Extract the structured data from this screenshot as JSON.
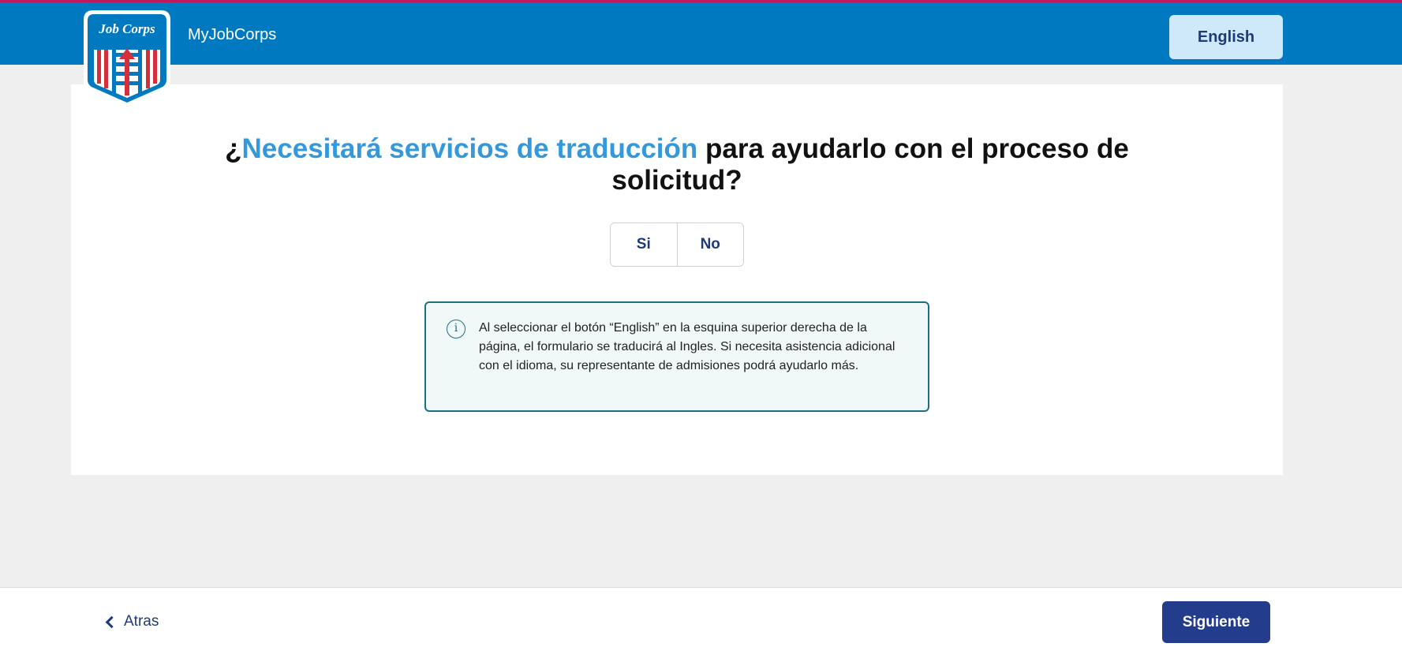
{
  "header": {
    "logo_text": "Job Corps",
    "brand_name": "MyJobCorps",
    "language_button": "English"
  },
  "question": {
    "prefix": "¿",
    "highlight": "Necesitará servicios de traducción",
    "rest": " para ayudarlo con el proceso de solicitud?"
  },
  "choices": {
    "yes": "Si",
    "no": "No"
  },
  "info": {
    "icon": "info-icon",
    "text": "Al seleccionar el botón “English” en la esquina superior derecha de la página, el formulario se traducirá al Ingles. Si necesita asistencia adicional con el idioma, su representante de admisiones podrá ayudarlo más."
  },
  "footer": {
    "back_label": "Atras",
    "next_label": "Siguiente"
  },
  "colors": {
    "header_blue": "#0079c1",
    "highlight_blue": "#3498db",
    "navy": "#1e3a78",
    "next_button": "#243c8c",
    "info_border": "#1f6f83"
  }
}
